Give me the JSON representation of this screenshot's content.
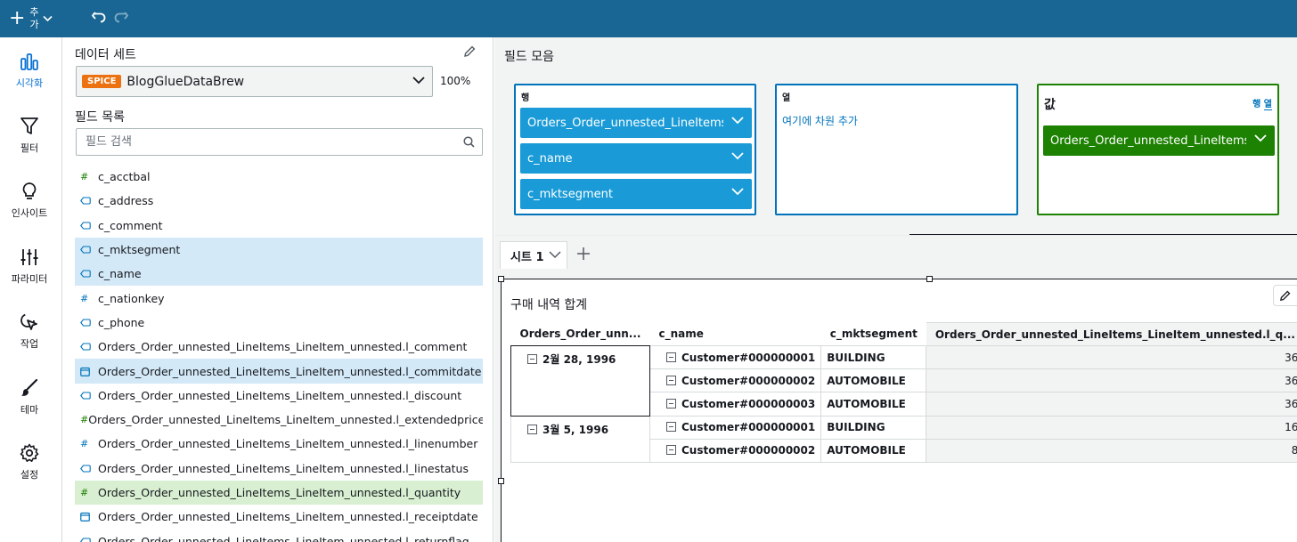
{
  "topbar": {
    "add_label": "추가",
    "undo_icon": "undo-icon",
    "redo_icon": "redo-icon",
    "bg_color": "#196694"
  },
  "nav": {
    "items": [
      {
        "label": "시각화",
        "icon": "bar-chart-icon",
        "active": true
      },
      {
        "label": "필터",
        "icon": "filter-icon"
      },
      {
        "label": "인사이트",
        "icon": "lightbulb-icon"
      },
      {
        "label": "파라미터",
        "icon": "sliders-icon"
      },
      {
        "label": "작업",
        "icon": "cursor-click-icon"
      },
      {
        "label": "테마",
        "icon": "brush-icon"
      },
      {
        "label": "설정",
        "icon": "gear-icon"
      }
    ]
  },
  "dataset": {
    "title": "데이터 세트",
    "badge": "SPICE",
    "name": "BlogGlueDataBrew",
    "spice_usage": "100%"
  },
  "field_list": {
    "title": "필드 목록",
    "search_placeholder": "필드 검색",
    "fields": [
      {
        "name": "c_acctbal",
        "type": "numeric-measure",
        "icon": "#"
      },
      {
        "name": "c_address",
        "type": "string"
      },
      {
        "name": "c_comment",
        "type": "string"
      },
      {
        "name": "c_mktsegment",
        "type": "string",
        "selected": "blue"
      },
      {
        "name": "c_name",
        "type": "string",
        "selected": "blue"
      },
      {
        "name": "c_nationkey",
        "type": "numeric-dimension",
        "icon": "#"
      },
      {
        "name": "c_phone",
        "type": "string"
      },
      {
        "name": "Orders_Order_unnested_LineItems_LineItem_unnested.l_comment",
        "type": "string"
      },
      {
        "name": "Orders_Order_unnested_LineItems_LineItem_unnested.l_commitdate",
        "type": "date",
        "selected": "blue"
      },
      {
        "name": "Orders_Order_unnested_LineItems_LineItem_unnested.l_discount",
        "type": "string"
      },
      {
        "name": "Orders_Order_unnested_LineItems_LineItem_unnested.l_extendedprice",
        "type": "numeric-measure",
        "icon": "#"
      },
      {
        "name": "Orders_Order_unnested_LineItems_LineItem_unnested.l_linenumber",
        "type": "numeric-dimension",
        "icon": "#"
      },
      {
        "name": "Orders_Order_unnested_LineItems_LineItem_unnested.l_linestatus",
        "type": "string"
      },
      {
        "name": "Orders_Order_unnested_LineItems_LineItem_unnested.l_quantity",
        "type": "numeric-measure",
        "icon": "#",
        "selected": "green"
      },
      {
        "name": "Orders_Order_unnested_LineItems_LineItem_unnested.l_receiptdate",
        "type": "date"
      },
      {
        "name": "Orders_Order_unnested_LineItems_LineItem_unnested.l_returnflag",
        "type": "string"
      }
    ]
  },
  "field_wells": {
    "title": "필드 모음",
    "rows": {
      "title": "행",
      "items": [
        "Orders_Order_unnested_LineItems_LineItem_unnested.l_commitdate",
        "c_name",
        "c_mktsegment"
      ]
    },
    "columns": {
      "title": "열",
      "placeholder": "여기에 차원 추가"
    },
    "values": {
      "title": "값",
      "toggle_row": "행",
      "toggle_col": "열",
      "items": [
        "Orders_Order_unnested_LineItems_LineItem_unnested.l_quantity"
      ]
    }
  },
  "sheets": {
    "tabs": [
      {
        "label": "시트 1"
      }
    ],
    "add_icon": "plus-icon"
  },
  "visual": {
    "title": "구매 내역 합계",
    "columns": [
      "Orders_Order_unn...",
      "c_name",
      "c_mktsegment",
      "Orders_Order_unnested_LineItems_LineItem_unnested.l_q..."
    ],
    "rows": [
      {
        "date": "2월 28, 1996",
        "customer": "Customer#000000001",
        "segment": "BUILDING",
        "value": "36"
      },
      {
        "date": "",
        "customer": "Customer#000000002",
        "segment": "AUTOMOBILE",
        "value": "36"
      },
      {
        "date": "",
        "customer": "Customer#000000003",
        "segment": "AUTOMOBILE",
        "value": "36"
      },
      {
        "date": "3월 5, 1996",
        "customer": "Customer#000000001",
        "segment": "BUILDING",
        "value": "16"
      },
      {
        "date": "",
        "customer": "Customer#000000002",
        "segment": "AUTOMOBILE",
        "value": "8"
      }
    ]
  }
}
